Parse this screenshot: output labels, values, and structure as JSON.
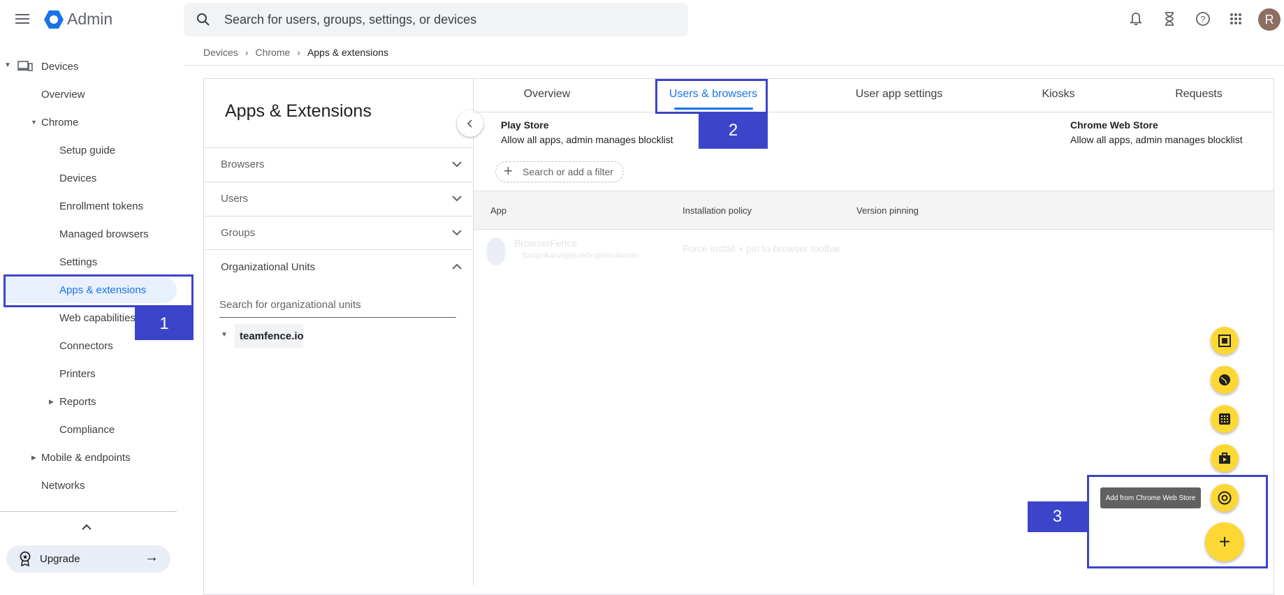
{
  "header": {
    "app_name": "Admin",
    "search_placeholder": "Search for users, groups, settings, or devices",
    "avatar_initial": "R",
    "icons": [
      "menu-icon",
      "bell-icon",
      "hourglass-icon",
      "help-icon",
      "apps-grid-icon"
    ]
  },
  "breadcrumb": [
    "Devices",
    "Chrome",
    "Apps & extensions"
  ],
  "sidebar": {
    "devices": "Devices",
    "overview": "Overview",
    "chrome": "Chrome",
    "chrome_items": [
      "Setup guide",
      "Devices",
      "Enrollment tokens",
      "Managed browsers",
      "Settings",
      "Apps & extensions",
      "Web capabilities",
      "Connectors",
      "Printers",
      "Reports",
      "Compliance"
    ],
    "mobile": "Mobile & endpoints",
    "networks": "Networks",
    "upgrade": "Upgrade"
  },
  "panel": {
    "title": "Apps & Extensions",
    "sections": [
      "Browsers",
      "Users",
      "Groups",
      "Organizational Units"
    ],
    "ou_search_placeholder": "Search for organizational units",
    "ou_root": "teamfence.io"
  },
  "tabs": [
    "Overview",
    "Users & browsers",
    "User app settings",
    "Kiosks",
    "Requests"
  ],
  "stores": {
    "play_title": "Play Store",
    "play_desc": "Allow all apps, admin manages blocklist",
    "cws_title": "Chrome Web Store",
    "cws_desc": "Allow all apps, admin manages blocklist"
  },
  "filter_placeholder": "Search or add a filter",
  "table": {
    "headers": [
      "App",
      "Installation policy",
      "Version pinning"
    ],
    "rows": [
      {
        "name": "BrowserFence",
        "id": "fpcdpokahaigejoxkhogbeindaosan",
        "policy": "Force install + pin to browser toolbar"
      }
    ]
  },
  "fab": {
    "tooltip": "Add from Chrome Web Store"
  },
  "annotations": [
    "1",
    "2",
    "3"
  ],
  "colors": {
    "accent": "#1a73e8",
    "annotation": "#3c45c9",
    "fab": "#fdd835"
  }
}
